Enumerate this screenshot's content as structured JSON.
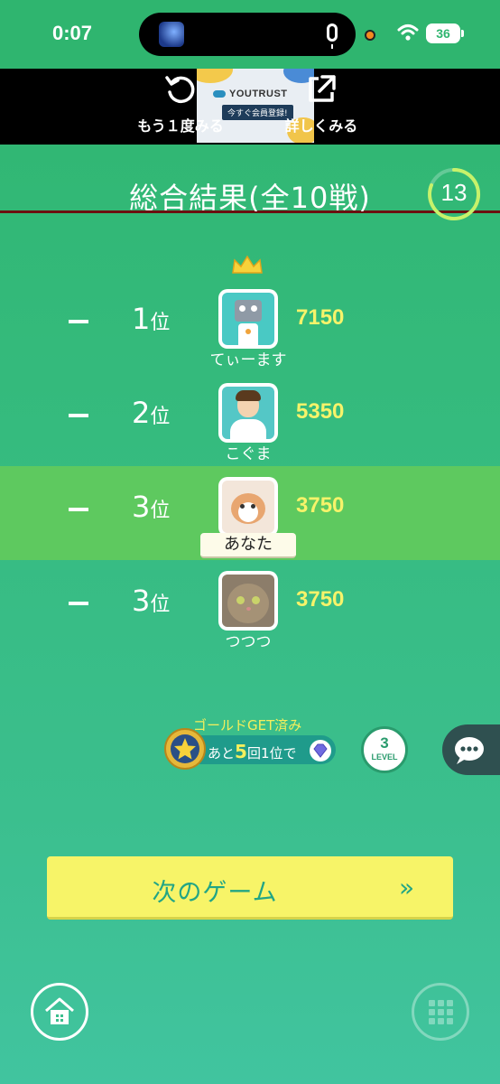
{
  "status_bar": {
    "time": "0:07",
    "battery": "36"
  },
  "ad": {
    "replay_label": "もう１度みる",
    "detail_label": "詳しくみる",
    "logo": "YOUTRUST",
    "cta": "今すぐ会員登録!"
  },
  "title": "総合結果(全10戦)",
  "timer": "13",
  "rankings": [
    {
      "rank": "1",
      "suffix": "位",
      "name": "てぃーます",
      "score": "7150"
    },
    {
      "rank": "2",
      "suffix": "位",
      "name": "こぐま",
      "score": "5350"
    },
    {
      "rank": "3",
      "suffix": "位",
      "name": "あなた",
      "score": "3750"
    },
    {
      "rank": "3",
      "suffix": "位",
      "name": "つつつ",
      "score": "3750"
    }
  ],
  "badge": {
    "gold_label": "ゴールドGET済み",
    "progress_prefix": "あと",
    "progress_count": "5",
    "progress_suffix": "回1位で",
    "level": "3",
    "level_label": "LEVEL"
  },
  "next_button_label": "次のゲーム",
  "next_arrow": "»",
  "colors": {
    "background": "#35bb7e",
    "highlight_row": "#5ec95f",
    "score": "#f6f36a",
    "button": "#f7f468",
    "button_text": "#22a585"
  },
  "icons": [
    "replay-icon",
    "external-link-icon",
    "crown-icon",
    "medal-icon",
    "diamond-icon",
    "chat-icon",
    "home-icon",
    "grid-icon",
    "wifi-icon",
    "mic-icon"
  ]
}
